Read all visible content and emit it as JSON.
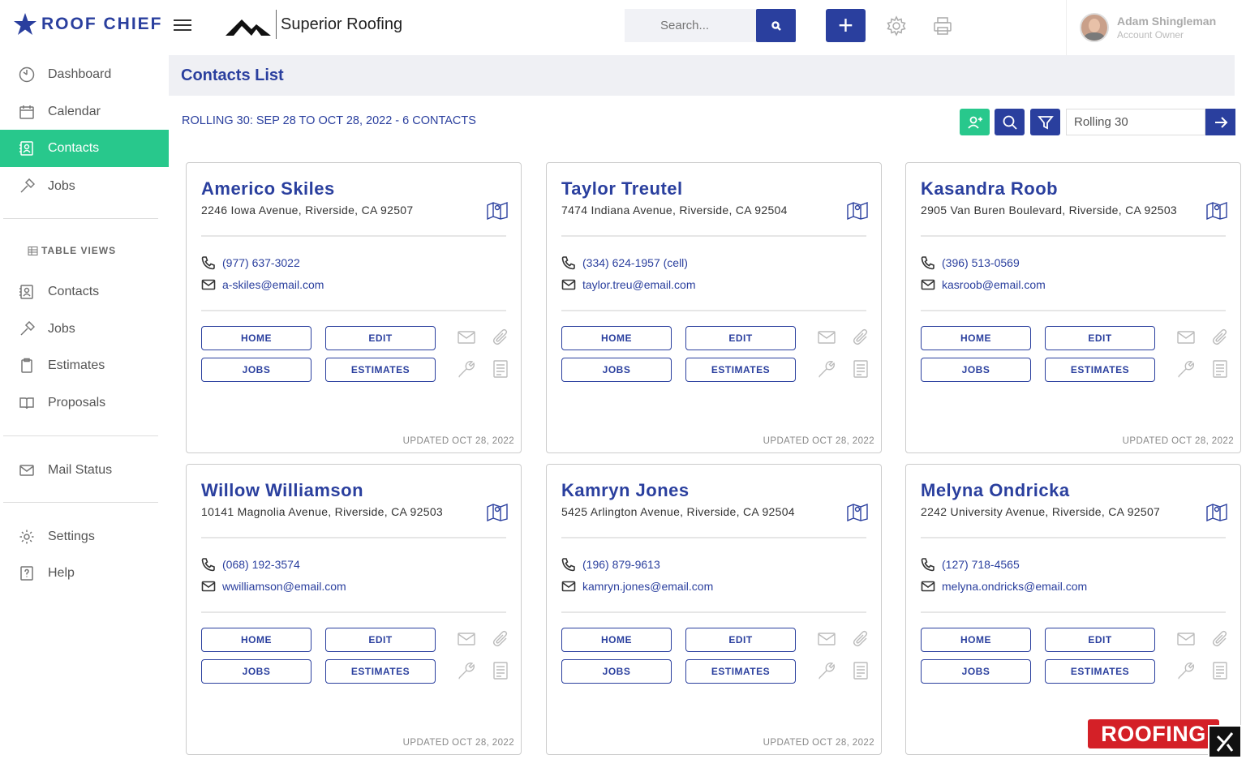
{
  "app": {
    "logo_text": "ROOF CHIEF",
    "company_name": "Superior Roofing"
  },
  "colors": {
    "accent": "#2a3f9e",
    "active_nav": "#28c88c",
    "add_contact": "#28c88c",
    "badge_red": "#d42027"
  },
  "sidebar": {
    "primary": [
      {
        "label": "Dashboard",
        "icon": "dashboard-icon"
      },
      {
        "label": "Calendar",
        "icon": "calendar-icon"
      },
      {
        "label": "Contacts",
        "icon": "contacts-icon",
        "active": true
      },
      {
        "label": "Jobs",
        "icon": "hammer-icon"
      }
    ],
    "section_label": "TABLE VIEWS",
    "table_views": [
      {
        "label": "Contacts",
        "icon": "contacts-icon"
      },
      {
        "label": "Jobs",
        "icon": "hammer-icon"
      },
      {
        "label": "Estimates",
        "icon": "clipboard-icon"
      },
      {
        "label": "Proposals",
        "icon": "book-icon"
      }
    ],
    "mail": {
      "label": "Mail Status",
      "icon": "mail-icon"
    },
    "bottom": [
      {
        "label": "Settings",
        "icon": "gear-icon"
      },
      {
        "label": "Help",
        "icon": "help-icon"
      }
    ]
  },
  "topbar": {
    "search_placeholder": "Search...",
    "user_name": "Adam Shingleman",
    "user_role": "Account Owner"
  },
  "page": {
    "title": "Contacts List",
    "range_info": "ROLLING 30: SEP 28 TO OCT 28, 2022 - 6 CONTACTS",
    "range_value": "Rolling 30"
  },
  "card_labels": {
    "home": "HOME",
    "edit": "EDIT",
    "jobs": "JOBS",
    "estimates": "ESTIMATES"
  },
  "contacts": [
    {
      "name": "Americo Skiles",
      "address": "2246 Iowa Avenue, Riverside, CA 92507",
      "phone": "(977) 637-3022",
      "email": "a-skiles@email.com",
      "updated": "UPDATED OCT 28, 2022"
    },
    {
      "name": "Taylor Treutel",
      "address": "7474 Indiana Avenue, Riverside, CA 92504",
      "phone": "(334) 624-1957 (cell)",
      "email": "taylor.treu@email.com",
      "updated": "UPDATED OCT 28, 2022"
    },
    {
      "name": "Kasandra Roob",
      "address": "2905 Van Buren Boulevard, Riverside, CA 92503",
      "phone": "(396) 513-0569",
      "email": "kasroob@email.com",
      "updated": "UPDATED OCT 28, 2022"
    },
    {
      "name": "Willow Williamson",
      "address": "10141 Magnolia Avenue, Riverside, CA 92503",
      "phone": "(068) 192-3574",
      "email": "wwilliamson@email.com",
      "updated": "UPDATED OCT 28, 2022"
    },
    {
      "name": "Kamryn Jones",
      "address": "5425 Arlington Avenue, Riverside, CA 92504",
      "phone": "(196) 879-9613",
      "email": "kamryn.jones@email.com",
      "updated": "UPDATED OCT 28, 2022"
    },
    {
      "name": "Melyna Ondricka",
      "address": "2242 University Avenue, Riverside, CA 92507",
      "phone": "(127) 718-4565",
      "email": "melyna.ondricks@email.com",
      "updated": ""
    }
  ],
  "badge": {
    "text": "ROOFING"
  }
}
